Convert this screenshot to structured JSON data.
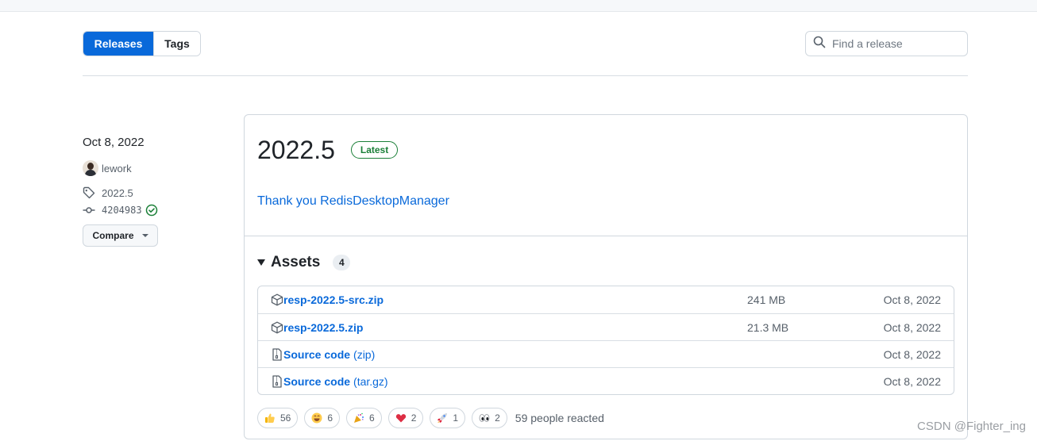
{
  "tabs": {
    "releases": "Releases",
    "tags": "Tags"
  },
  "search": {
    "placeholder": "Find a release"
  },
  "sidebar": {
    "date": "Oct 8, 2022",
    "author": "lework",
    "tag": "2022.5",
    "commit": "4204983",
    "compare_label": "Compare"
  },
  "release": {
    "title": "2022.5",
    "badge": "Latest",
    "description": "Thank you RedisDesktopManager"
  },
  "assets": {
    "label": "Assets",
    "count": "4",
    "items": [
      {
        "name": "resp-2022.5-src.zip",
        "sub": "",
        "size": "241 MB",
        "date": "Oct 8, 2022",
        "icon": "package-icon"
      },
      {
        "name": "resp-2022.5.zip",
        "sub": "",
        "size": "21.3 MB",
        "date": "Oct 8, 2022",
        "icon": "package-icon"
      },
      {
        "name": "Source code",
        "sub": "(zip)",
        "size": "",
        "date": "Oct 8, 2022",
        "icon": "file-zip-icon"
      },
      {
        "name": "Source code",
        "sub": "(tar.gz)",
        "size": "",
        "date": "Oct 8, 2022",
        "icon": "file-zip-icon"
      }
    ]
  },
  "reactions": {
    "items": [
      {
        "icon": "thumbs-up-icon",
        "count": "56"
      },
      {
        "icon": "laugh-icon",
        "count": "6"
      },
      {
        "icon": "hooray-icon",
        "count": "6"
      },
      {
        "icon": "heart-icon",
        "count": "2"
      },
      {
        "icon": "rocket-icon",
        "count": "1"
      },
      {
        "icon": "eyes-icon",
        "count": "2"
      }
    ],
    "summary": "59 people reacted"
  },
  "watermark": "CSDN @Fighter_ing",
  "colors": {
    "accent": "#0969da",
    "latest_green": "#1a7f37",
    "verified_green": "#1a7f37"
  }
}
